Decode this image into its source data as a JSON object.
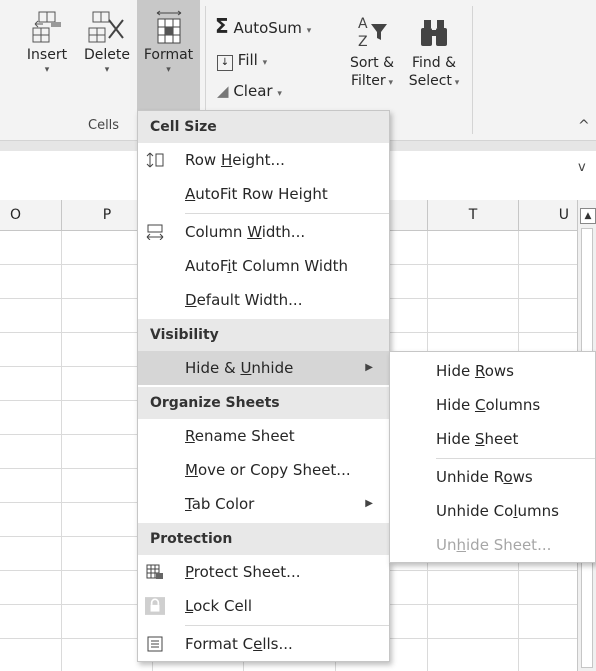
{
  "ribbon": {
    "insert_label": "Insert",
    "delete_label": "Delete",
    "format_label": "Format",
    "cells_group_label": "Cells",
    "autosum_label": "AutoSum",
    "fill_label": "Fill",
    "clear_label": "Clear",
    "sort_filter_line1": "Sort &",
    "sort_filter_line2": "Filter",
    "find_select_line1": "Find &",
    "find_select_line2": "Select",
    "collapse_glyph": "^",
    "formula_expand_glyph": "v"
  },
  "columns": [
    "O",
    "P",
    "T",
    "U"
  ],
  "menu": {
    "sections": {
      "cell_size": "Cell Size",
      "visibility": "Visibility",
      "organize": "Organize Sheets",
      "protection": "Protection"
    },
    "items": {
      "row_height": {
        "pre": "Row ",
        "u": "H",
        "post": "eight..."
      },
      "autofit_row_height": {
        "pre": "",
        "u": "A",
        "post": "utoFit Row Height"
      },
      "column_width": {
        "pre": "Column ",
        "u": "W",
        "post": "idth..."
      },
      "autofit_column_width": {
        "pre": "AutoF",
        "u": "i",
        "post": "t Column Width"
      },
      "default_width": {
        "pre": "",
        "u": "D",
        "post": "efault Width..."
      },
      "hide_unhide": {
        "pre": "Hide & ",
        "u": "U",
        "post": "nhide"
      },
      "rename_sheet": {
        "pre": "",
        "u": "R",
        "post": "ename Sheet"
      },
      "move_copy_sheet": {
        "pre": "",
        "u": "M",
        "post": "ove or Copy Sheet..."
      },
      "tab_color": {
        "pre": "",
        "u": "T",
        "post": "ab Color"
      },
      "protect_sheet": {
        "pre": "",
        "u": "P",
        "post": "rotect Sheet..."
      },
      "lock_cell": {
        "pre": "",
        "u": "L",
        "post": "ock Cell"
      },
      "format_cells": {
        "pre": "Format C",
        "u": "e",
        "post": "lls..."
      }
    }
  },
  "submenu": {
    "hide_rows": {
      "pre": "Hide ",
      "u": "R",
      "post": "ows"
    },
    "hide_columns": {
      "pre": "Hide ",
      "u": "C",
      "post": "olumns"
    },
    "hide_sheet": {
      "pre": "Hide ",
      "u": "S",
      "post": "heet"
    },
    "unhide_rows": {
      "pre": "Unhide R",
      "u": "o",
      "post": "ws"
    },
    "unhide_columns": {
      "pre": "Unhide Co",
      "u": "l",
      "post": "umns"
    },
    "unhide_sheet": {
      "pre": "Un",
      "u": "h",
      "post": "ide Sheet..."
    }
  },
  "colors": {
    "ribbon_bg": "#f3f3f3",
    "menu_header_bg": "#e8e8e8",
    "highlight": "#d6d6d6",
    "disabled_text": "#a6a6a6"
  }
}
